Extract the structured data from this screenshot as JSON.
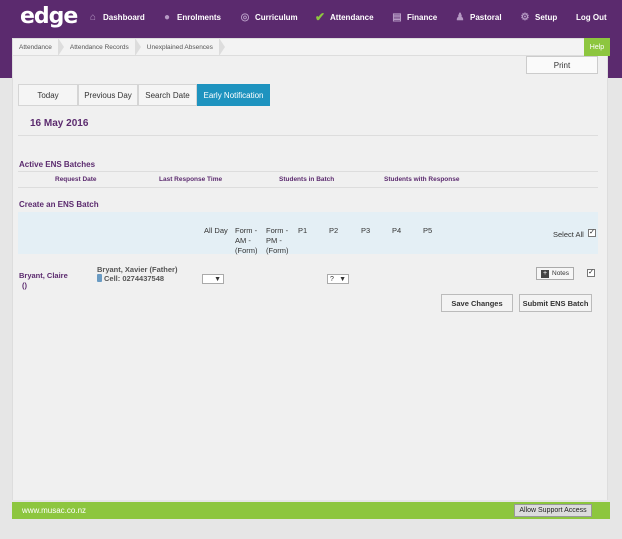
{
  "nav": {
    "logo": "edge",
    "items": [
      {
        "label": "Dashboard",
        "icon": "house-icon"
      },
      {
        "label": "Enrolments",
        "icon": "person-icon"
      },
      {
        "label": "Curriculum",
        "icon": "people-icon"
      },
      {
        "label": "Attendance",
        "icon": "checkmark-icon"
      },
      {
        "label": "Finance",
        "icon": "money-icon"
      },
      {
        "label": "Pastoral",
        "icon": "pastoral-icon"
      },
      {
        "label": "Setup",
        "icon": "gear-icon"
      }
    ],
    "logout": "Log Out"
  },
  "breadcrumb": [
    "Attendance",
    "Attendance Records",
    "Unexplained Absences"
  ],
  "help": "Help",
  "print": "Print",
  "tabs": [
    {
      "label": "Today",
      "active": false
    },
    {
      "label": "Previous Day",
      "active": false
    },
    {
      "label": "Search Date",
      "active": false
    },
    {
      "label": "Early Notification",
      "active": true
    }
  ],
  "date": "16 May 2016",
  "active_batches": {
    "title": "Active ENS Batches",
    "columns": [
      "Request Date",
      "Last Response Time",
      "Students in Batch",
      "Students with Response"
    ]
  },
  "create": {
    "title": "Create an ENS Batch",
    "columns": [
      "All Day",
      "Form - AM - (Form)",
      "Form - PM - (Form)",
      "P1",
      "P2",
      "P3",
      "P4",
      "P5"
    ],
    "select_all": "Select All",
    "rows": [
      {
        "student_line1": "Bryant, Claire",
        "student_line2": "()",
        "contact_name": "Bryant, Xavier (Father)",
        "contact_cell": "Cell: 0274437548",
        "all_day": "",
        "p2": "?",
        "notes": "Notes"
      }
    ]
  },
  "buttons": {
    "save": "Save Changes",
    "submit": "Submit ENS Batch"
  },
  "footer": {
    "url": "www.musac.co.nz",
    "support": "Allow Support Access"
  },
  "colors": {
    "brand_purple": "#5b2a6e",
    "accent_green": "#8dc63f",
    "active_tab": "#1e93bf"
  }
}
